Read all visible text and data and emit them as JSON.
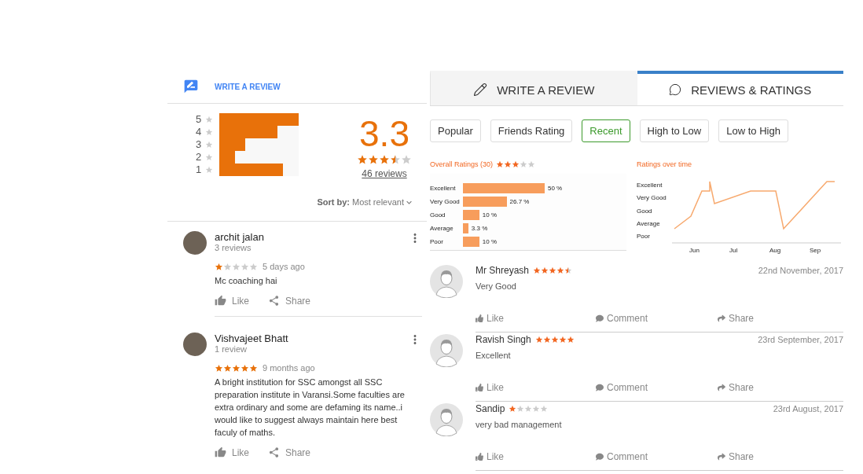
{
  "google_panel": {
    "write_review": "WRITE A REVIEW",
    "histogram": [
      {
        "label": "5",
        "level": 1.0
      },
      {
        "label": "4",
        "level": 0.73
      },
      {
        "label": "3",
        "level": 0.33
      },
      {
        "label": "2",
        "level": 0.2
      },
      {
        "label": "1",
        "level": 0.8
      }
    ],
    "score": "3.3",
    "stars": 3.5,
    "review_count": "46 reviews",
    "sort_label": "Sort by:",
    "sort_value": "Most relevant",
    "reviews": [
      {
        "name": "archit jalan",
        "meta": "3 reviews",
        "stars": 1,
        "time": "5 days ago",
        "text": "Mc coaching hai",
        "like": "Like",
        "share": "Share"
      },
      {
        "name": "Vishvajeet Bhatt",
        "meta": "1 review",
        "stars": 5,
        "time": "9 months ago",
        "text": "A bright institution for SSC amongst all SSC preparation institute in Varansi.Some faculties are extra ordinary and some are defaming its name..i would like to suggest always maintain here best faculy of maths.",
        "like": "Like",
        "share": "Share"
      }
    ]
  },
  "site_panel": {
    "tabs": [
      {
        "label": "WRITE A REVIEW",
        "kind": "write",
        "selected": false
      },
      {
        "label": "REVIEWS & RATINGS",
        "kind": "reviews",
        "selected": true
      }
    ],
    "filters": [
      {
        "label": "Popular",
        "selected": false
      },
      {
        "label": "Friends Rating",
        "selected": false
      },
      {
        "label": "Recent",
        "selected": true
      },
      {
        "label": "High to Low",
        "selected": false
      },
      {
        "label": "Low to High",
        "selected": false
      }
    ],
    "overall_ratings": {
      "stars": 3,
      "chart_data": {
        "type": "bar",
        "orientation": "horizontal",
        "title": "Overall Ratings (30)",
        "categories": [
          "Excellent",
          "Very Good",
          "Good",
          "Average",
          "Poor"
        ],
        "values": [
          50,
          26.7,
          10,
          3.3,
          10
        ],
        "value_labels": [
          "50 %",
          "26.7 %",
          "10 %",
          "3.3 %",
          "10 %"
        ]
      }
    },
    "ratings_over_time": {
      "title": "Ratings over time",
      "y_labels": [
        "Excellent",
        "Very Good",
        "Good",
        "Average",
        "Poor"
      ],
      "x_labels": [
        "Jun",
        "Jul",
        "Aug",
        "Sep"
      ]
    },
    "reviews": [
      {
        "name": "Mr Shreyash",
        "stars": 4.5,
        "date": "22nd November, 2017",
        "text": "Very Good",
        "like": "Like",
        "comment": "Comment",
        "share": "Share"
      },
      {
        "name": "Ravish Singh",
        "stars": 5,
        "date": "23rd September, 2017",
        "text": "Excellent",
        "like": "Like",
        "comment": "Comment",
        "share": "Share"
      },
      {
        "name": "Sandip",
        "stars": 1,
        "date": "23rd August, 2017",
        "text": "very bad management",
        "like": "Like",
        "comment": "Comment",
        "share": "Share"
      }
    ]
  }
}
